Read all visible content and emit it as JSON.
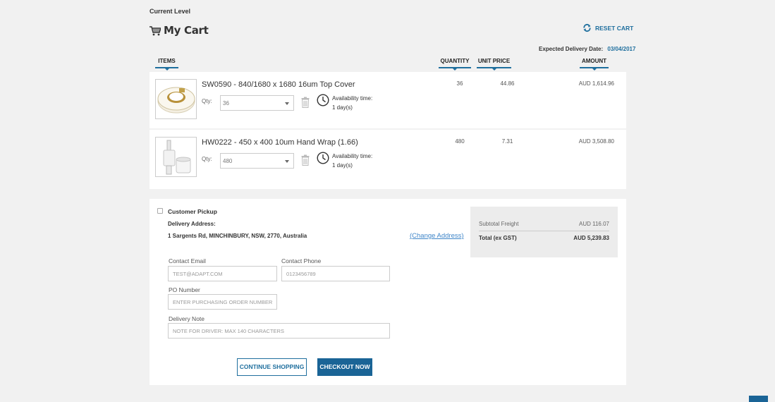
{
  "header": {
    "current_level": "Current Level",
    "title": "My Cart",
    "reset_label": "RESET CART",
    "expected_delivery_label": "Expected Delivery Date:",
    "expected_delivery_value": "03/04/2017"
  },
  "columns": {
    "items": "ITEMS",
    "quantity": "QUANTITY",
    "unit_price": "UNIT PRICE",
    "amount": "AMOUNT"
  },
  "items": [
    {
      "name": "SW0590 - 840/1680 x 1680 16um Top Cover",
      "qty_label": "Qty:",
      "qty_value": "36",
      "availability_label": "Availability time:",
      "availability_value": "1 day(s)",
      "quantity": "36",
      "unit_price": "44.86",
      "amount": "AUD 1,614.96",
      "image_icon": "tape-roll-icon"
    },
    {
      "name": "HW0222 - 450 x 400 10um Hand Wrap (1.66)",
      "qty_label": "Qty:",
      "qty_value": "480",
      "availability_label": "Availability time:",
      "availability_value": "1 day(s)",
      "quantity": "480",
      "unit_price": "7.31",
      "amount": "AUD 3,508.80",
      "image_icon": "hand-wrap-icon"
    }
  ],
  "delivery": {
    "pickup_label": "Customer Pickup",
    "address_label": "Delivery Address:",
    "address": "1 Sargents Rd, MINCHINBURY, NSW, 2770, Australia",
    "change_address": "(Change Address)"
  },
  "form": {
    "contact_email_label": "Contact Email",
    "contact_email_value": "TEST@ADAPT.COM",
    "contact_phone_label": "Contact Phone",
    "contact_phone_value": "0123456789",
    "po_label": "PO Number",
    "po_placeholder": "ENTER PURCHASING ORDER NUMBER",
    "note_label": "Delivery Note",
    "note_placeholder": "NOTE FOR DRIVER: MAX 140 CHARACTERS"
  },
  "buttons": {
    "continue": "CONTINUE SHOPPING",
    "checkout": "CHECKOUT NOW"
  },
  "summary": {
    "subtotal_freight_label": "Subtotal Freight",
    "subtotal_freight_value": "AUD 116.07",
    "total_label": "Total (ex GST)",
    "total_value": "AUD 5,239.83"
  },
  "colors": {
    "accent": "#1a6496",
    "link": "#3f86c9",
    "background": "#f1f1f1"
  }
}
